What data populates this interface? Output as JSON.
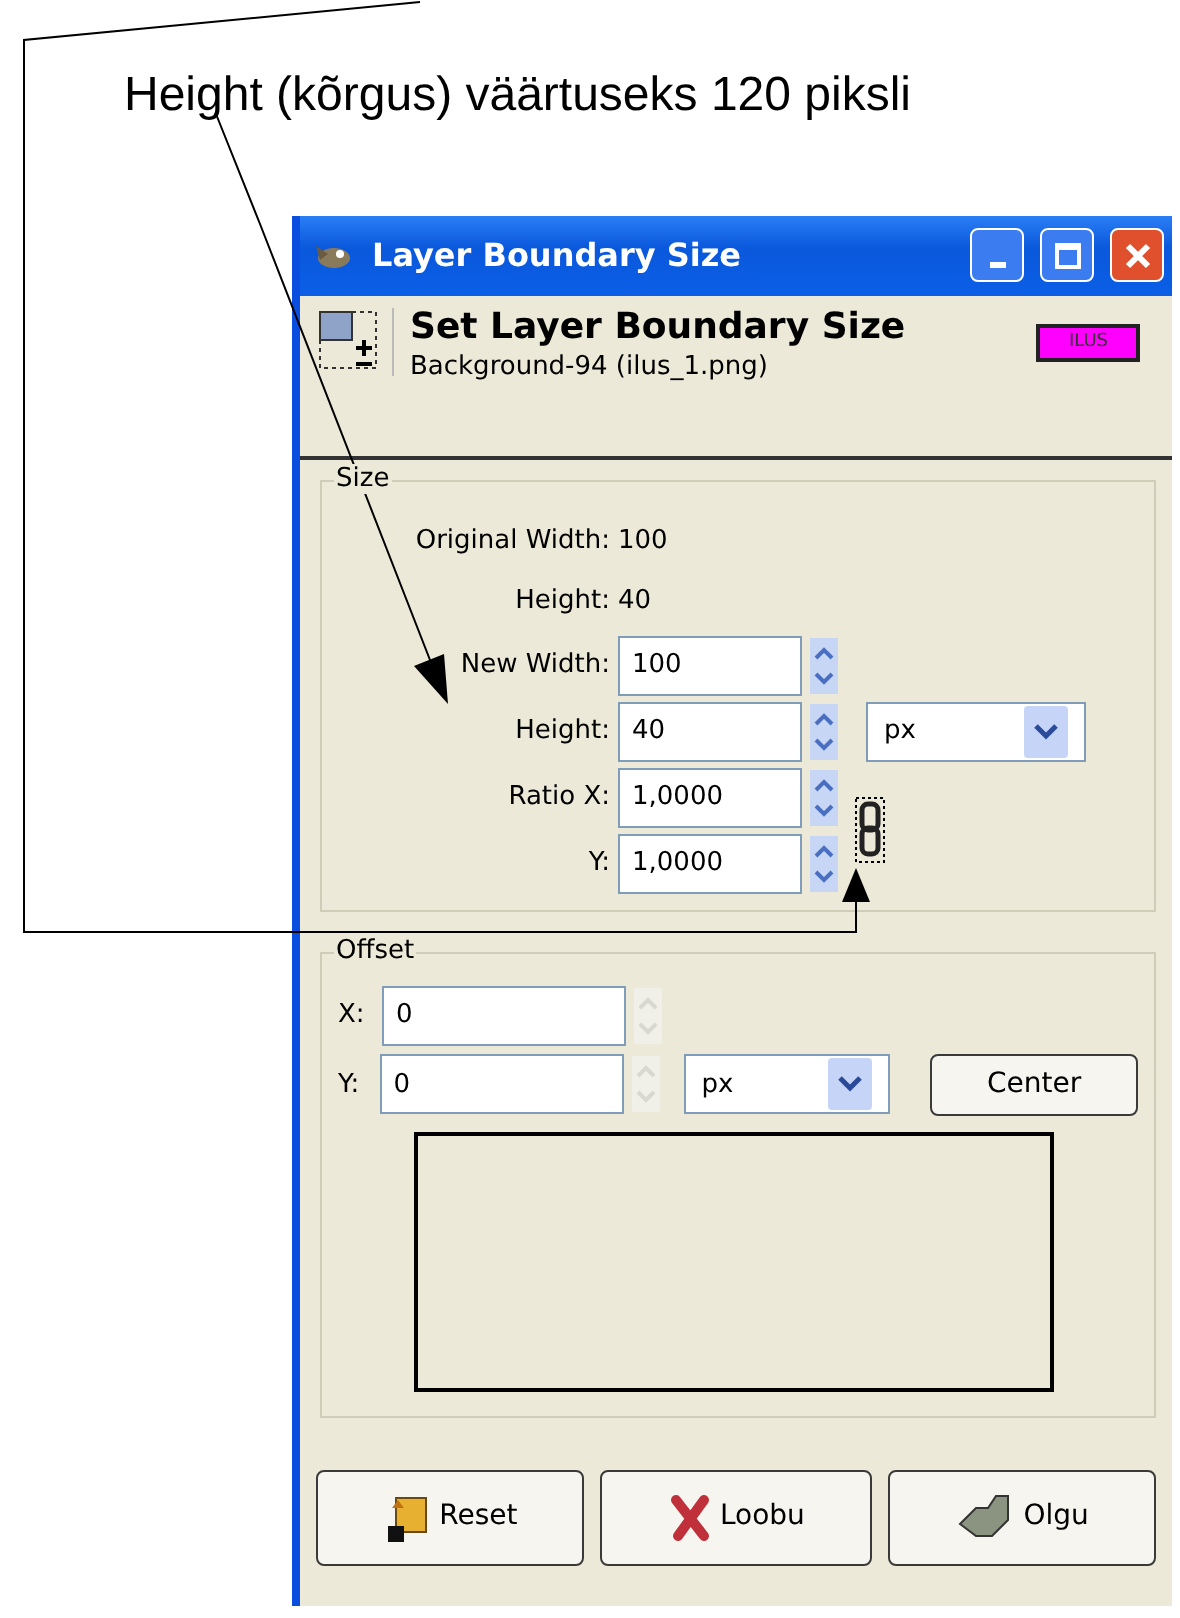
{
  "annotation": {
    "text": "Height (kõrgus) väärtuseks 120 piksli"
  },
  "window": {
    "title": "Layer Boundary Size"
  },
  "header": {
    "title": "Set Layer Boundary Size",
    "subtitle": "Background-94 (ilus_1.png)",
    "badge": "ILUS"
  },
  "size_group": {
    "legend": "Size",
    "info": [
      {
        "label": "Original Width:",
        "value": "100"
      },
      {
        "label": "Height:",
        "value": "40"
      }
    ],
    "fields": [
      {
        "label": "New Width:",
        "value": "100"
      },
      {
        "label": "Height:",
        "value": "40"
      },
      {
        "label": "Ratio X:",
        "value": "1,0000"
      },
      {
        "label": "Y:",
        "value": "1,0000"
      }
    ],
    "unit": "px",
    "chain_linked": true
  },
  "offset_group": {
    "legend": "Offset",
    "fields": [
      {
        "label": "X:",
        "value": "0"
      },
      {
        "label": "Y:",
        "value": "0"
      }
    ],
    "unit": "px",
    "center_button": "Center"
  },
  "buttons": [
    {
      "kind": "reset",
      "label": "Reset"
    },
    {
      "kind": "cancel",
      "label": "Loobu"
    },
    {
      "kind": "ok",
      "label": "Olgu"
    }
  ]
}
